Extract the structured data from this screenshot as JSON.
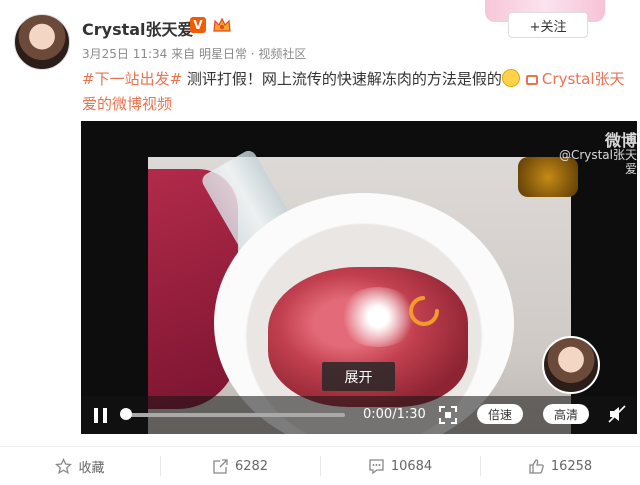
{
  "author": {
    "name": "Crystal张天爱",
    "verified_mark": "V"
  },
  "post": {
    "date": "3月25日 11:34",
    "source_prefix": "来自",
    "source": "明星日常 · 视频社区",
    "hashtag": "#下一站出发#",
    "text": " 测评打假！网上流传的快速解冻肉的方法是假的",
    "video_link": "Crystal张天爱的微博视频"
  },
  "follow": {
    "label": "+关注"
  },
  "video": {
    "watermark_logo": "微博",
    "watermark_user": "@Crystal张天爱",
    "expand_label": "展开",
    "time": "0:00/1:30",
    "progress": 0,
    "speed_label": "倍速",
    "quality_label": "高清"
  },
  "actions": {
    "favorite_label": "收藏",
    "repost_count": "6282",
    "comment_count": "10684",
    "like_count": "16258"
  },
  "colors": {
    "accent": "#eb7350",
    "vip": "#f55a00"
  },
  "icons": [
    "crown-icon",
    "video-icon",
    "pause-icon",
    "fullscreen-icon",
    "mute-icon",
    "star-icon",
    "repost-icon",
    "comment-icon",
    "like-icon",
    "loading-spinner-icon"
  ]
}
